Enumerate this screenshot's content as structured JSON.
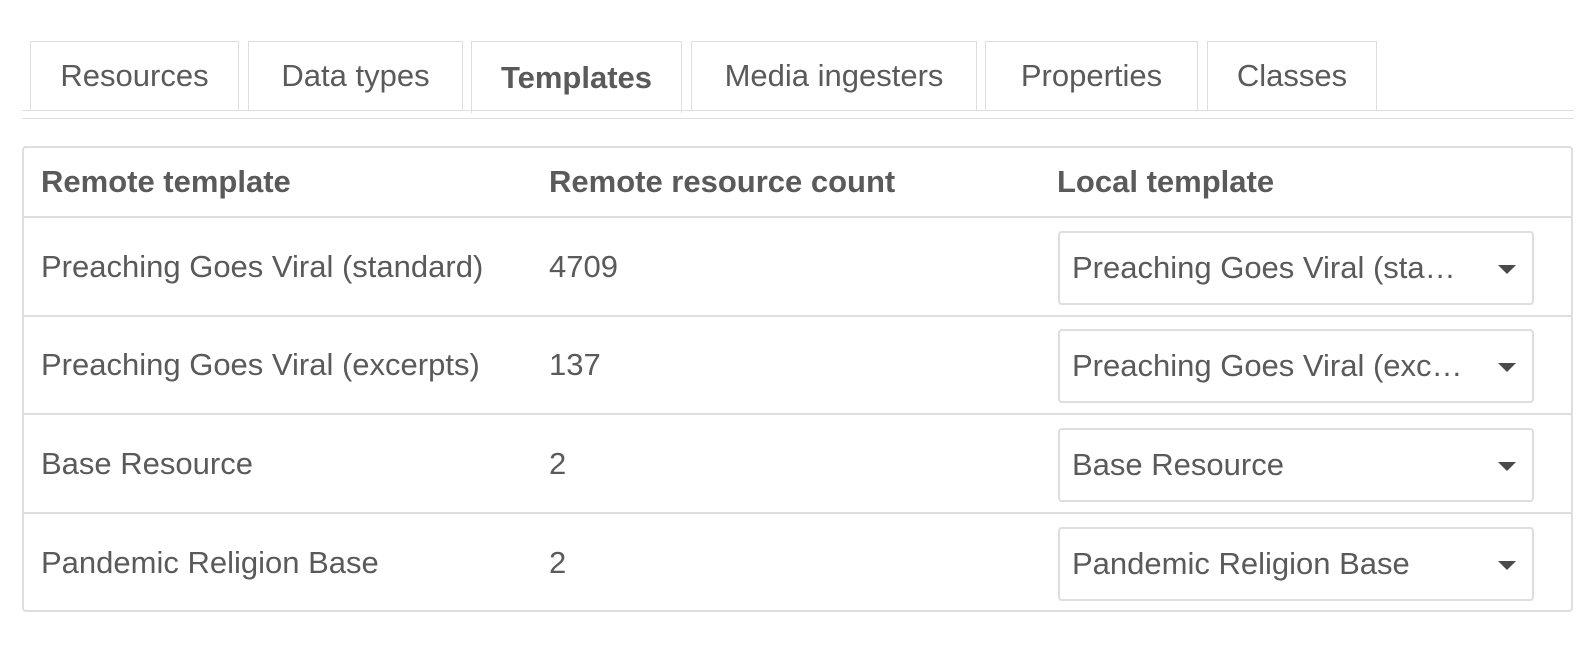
{
  "tabs": [
    {
      "label": "Resources",
      "active": false
    },
    {
      "label": "Data types",
      "active": false
    },
    {
      "label": "Templates",
      "active": true
    },
    {
      "label": "Media ingesters",
      "active": false
    },
    {
      "label": "Properties",
      "active": false
    },
    {
      "label": "Classes",
      "active": false
    }
  ],
  "table": {
    "headers": [
      "Remote template",
      "Remote resource count",
      "Local template"
    ],
    "rows": [
      {
        "remote_template": "Preaching Goes Viral (standard)",
        "count": "4709",
        "local_template": "Preaching Goes Viral (standard)"
      },
      {
        "remote_template": "Preaching Goes Viral (excerpts)",
        "count": "137",
        "local_template": "Preaching Goes Viral (excerpts)"
      },
      {
        "remote_template": "Base Resource",
        "count": "2",
        "local_template": "Base Resource"
      },
      {
        "remote_template": "Pandemic Religion Base",
        "count": "2",
        "local_template": "Pandemic Religion Base"
      }
    ]
  },
  "icons": {
    "select_caret": "caret-down-icon"
  }
}
